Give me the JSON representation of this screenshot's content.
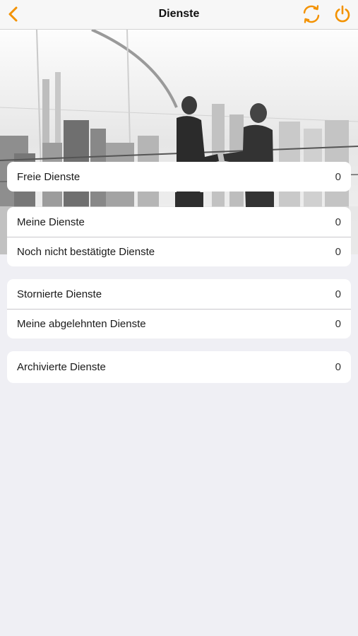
{
  "header": {
    "title": "Dienste"
  },
  "colors": {
    "accent": "#f39200",
    "background": "#efeff4",
    "card": "#ffffff"
  },
  "groups": [
    {
      "items": [
        {
          "label": "Freie Dienste",
          "count": "0"
        }
      ]
    },
    {
      "items": [
        {
          "label": "Meine Dienste",
          "count": "0"
        },
        {
          "label": "Noch nicht bestätigte Dienste",
          "count": "0"
        }
      ]
    },
    {
      "items": [
        {
          "label": "Stornierte Dienste",
          "count": "0"
        },
        {
          "label": "Meine abgelehnten Dienste",
          "count": "0"
        }
      ]
    },
    {
      "items": [
        {
          "label": "Archivierte Dienste",
          "count": "0"
        }
      ]
    }
  ]
}
